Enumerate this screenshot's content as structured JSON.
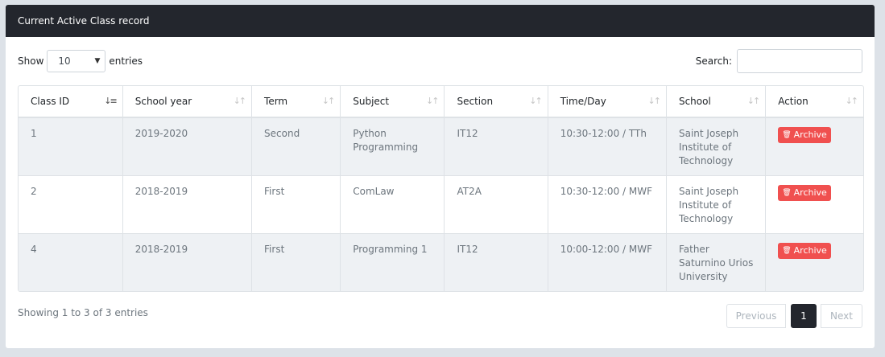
{
  "panel": {
    "title": "Current Active Class record"
  },
  "length": {
    "show_label": "Show",
    "value": "10",
    "entries_label": "entries"
  },
  "search": {
    "label": "Search:",
    "value": ""
  },
  "table": {
    "columns": [
      "Class ID",
      "School year",
      "Term",
      "Subject",
      "Section",
      "Time/Day",
      "School",
      "Action"
    ],
    "rows": [
      {
        "id": "1",
        "year": "2019-2020",
        "term": "Second",
        "subject": "Python Programming",
        "section": "IT12",
        "time": "10:30-12:00 / TTh",
        "school": "Saint Joseph Institute of Technology",
        "action": "Archive"
      },
      {
        "id": "2",
        "year": "2018-2019",
        "term": "First",
        "subject": "ComLaw",
        "section": "AT2A",
        "time": "10:30-12:00 / MWF",
        "school": "Saint Joseph Institute of Technology",
        "action": "Archive"
      },
      {
        "id": "4",
        "year": "2018-2019",
        "term": "First",
        "subject": "Programming 1",
        "section": "IT12",
        "time": "10:00-12:00 / MWF",
        "school": "Father Saturnino Urios University",
        "action": "Archive"
      }
    ]
  },
  "footer": {
    "info": "Showing 1 to 3 of 3 entries",
    "previous": "Previous",
    "current_page": "1",
    "next": "Next"
  },
  "colors": {
    "header_bg": "#23262d",
    "archive": "#f0504f",
    "row_stripe": "#eef1f4"
  },
  "icons": {
    "archive": "trash-icon",
    "sort": "sort-icon"
  }
}
